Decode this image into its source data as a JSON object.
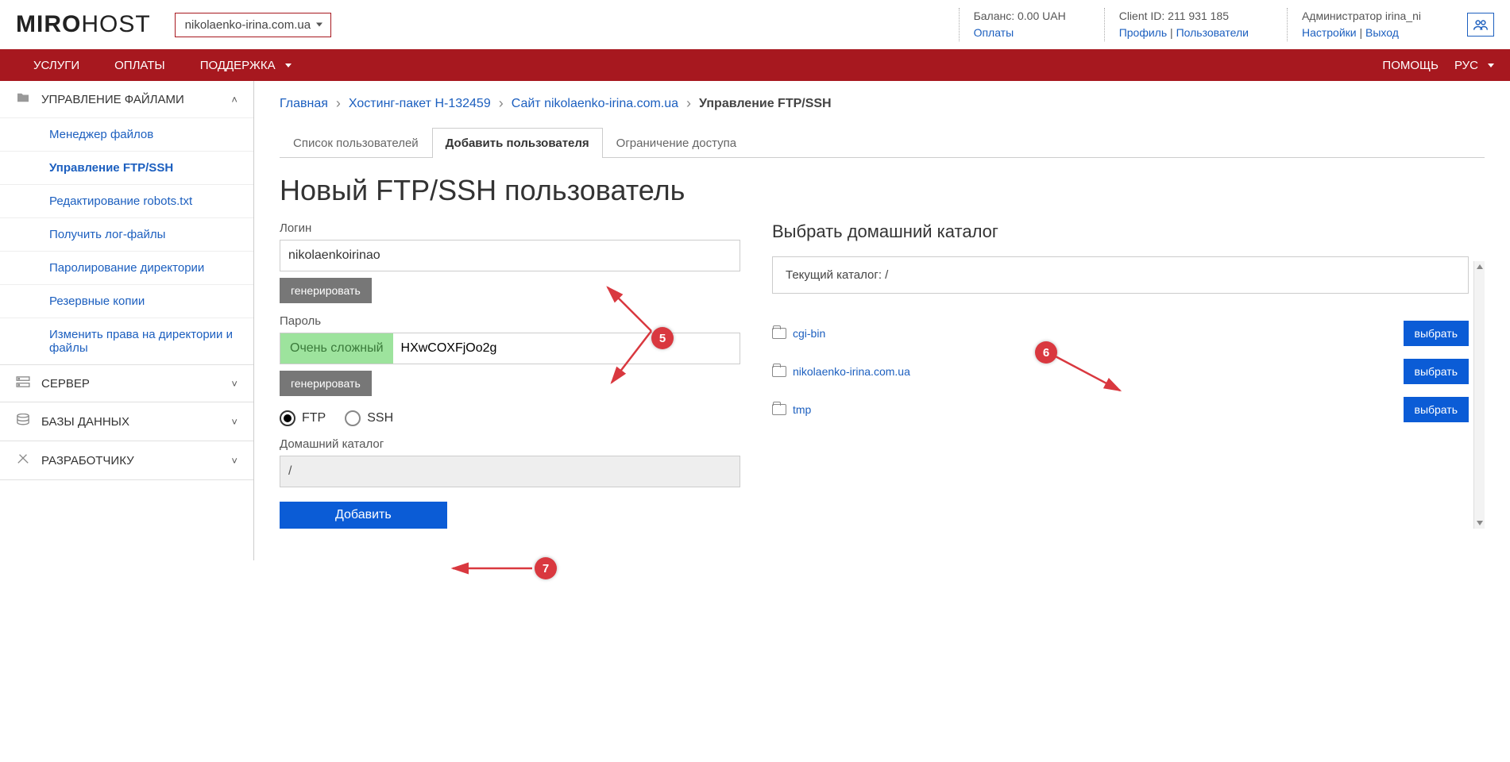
{
  "header": {
    "logo_left": "MIRO",
    "logo_right": "HOST",
    "domain": "nikolaenko-irina.com.ua",
    "balance_label": "Баланс: 0.00 UAH",
    "payments_link": "Оплаты",
    "client_label": "Client ID: 211 931 185",
    "profile_link": "Профиль",
    "users_link": "Пользователи",
    "admin_label": "Администратор irina_ni",
    "settings_link": "Настройки",
    "logout_link": "Выход"
  },
  "nav": {
    "services": "УСЛУГИ",
    "payments": "ОПЛАТЫ",
    "support": "ПОДДЕРЖКА",
    "help": "ПОМОЩЬ",
    "lang": "РУС"
  },
  "sidebar": {
    "files_section": "УПРАВЛЕНИЕ ФАЙЛАМИ",
    "items": [
      "Менеджер файлов",
      "Управление FTP/SSH",
      "Редактирование robots.txt",
      "Получить лог-файлы",
      "Паролирование директории",
      "Резервные копии",
      "Изменить права на директории и файлы"
    ],
    "server_section": "СЕРВЕР",
    "db_section": "БАЗЫ ДАННЫХ",
    "dev_section": "РАЗРАБОТЧИКУ"
  },
  "breadcrumb": {
    "home": "Главная",
    "pkg": "Хостинг-пакет H-132459",
    "site": "Сайт nikolaenko-irina.com.ua",
    "cur": "Управление FTP/SSH"
  },
  "tabs": {
    "list": "Список пользователей",
    "add": "Добавить пользователя",
    "restrict": "Ограничение доступа"
  },
  "page_title": "Новый FTP/SSH пользователь",
  "form": {
    "login_label": "Логин",
    "login_value": "nikolaenkoirinao",
    "generate": "генерировать",
    "password_label": "Пароль",
    "strength": "Очень сложный",
    "password_value": "HXwCOXFjOo2g",
    "ftp": "FTP",
    "ssh": "SSH",
    "home_label": "Домашний каталог",
    "home_value": "/",
    "submit": "Добавить"
  },
  "right": {
    "title": "Выбрать домашний каталог",
    "current_label": "Текущий каталог: /",
    "select": "выбрать",
    "dirs": [
      "cgi-bin",
      "nikolaenko-irina.com.ua",
      "tmp"
    ]
  },
  "anno": {
    "a5": "5",
    "a6": "6",
    "a7": "7"
  }
}
